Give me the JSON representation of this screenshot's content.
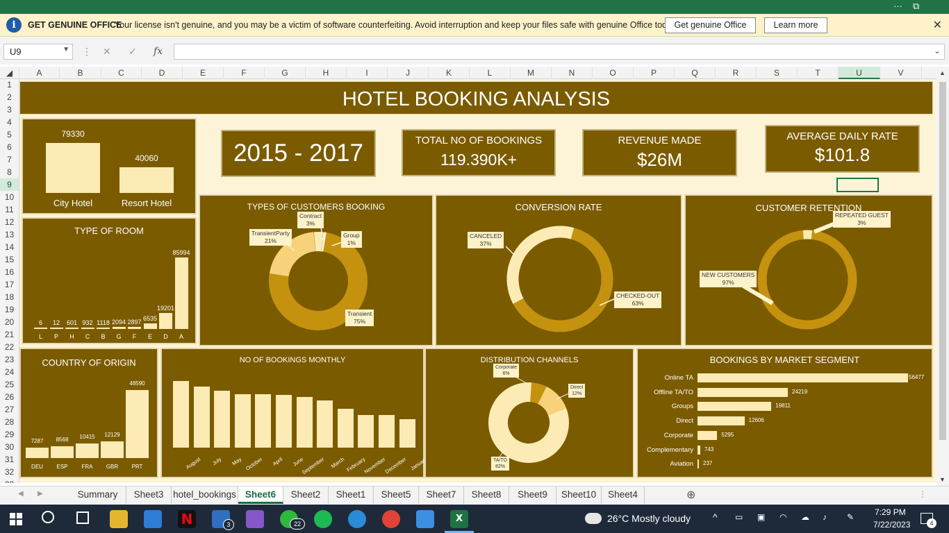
{
  "window": {
    "title_icons": [
      "more-icon",
      "restore-icon"
    ]
  },
  "banner": {
    "title": "GET GENUINE OFFICE",
    "message": "Your license isn't genuine, and you may be a victim of software counterfeiting. Avoid interruption and keep your files safe with genuine Office today.",
    "button1": "Get genuine Office",
    "button2": "Learn more",
    "close": "✕"
  },
  "formula_bar": {
    "name_box": "U9",
    "fx": "fx",
    "formula": ""
  },
  "columns": [
    "A",
    "B",
    "C",
    "D",
    "E",
    "F",
    "G",
    "H",
    "I",
    "J",
    "K",
    "L",
    "M",
    "N",
    "O",
    "P",
    "Q",
    "R",
    "S",
    "T",
    "U",
    "V"
  ],
  "selected_column": "U",
  "rows": [
    "1",
    "2",
    "3",
    "4",
    "5",
    "6",
    "7",
    "8",
    "9",
    "10",
    "11",
    "12",
    "13",
    "14",
    "15",
    "16",
    "17",
    "18",
    "19",
    "20",
    "21",
    "22",
    "23",
    "24",
    "25",
    "26",
    "27",
    "28",
    "29",
    "30",
    "31",
    "32",
    "33"
  ],
  "selected_row": "9",
  "dashboard": {
    "title": "HOTEL BOOKING ANALYSIS",
    "kpis": {
      "period": "2015 - 2017",
      "total_label": "TOTAL NO OF BOOKINGS",
      "total_value": "119.390K+",
      "revenue_label": "REVENUE MADE",
      "revenue_value": "$26M",
      "adr_label": "AVERAGE DAILY RATE",
      "adr_value": "$101.8"
    },
    "colors": {
      "panel": "#7b5b00",
      "background": "#fdf4d8",
      "light": "#fdebb5",
      "gold": "#c4920e"
    }
  },
  "chart_data": [
    {
      "id": "hotel",
      "type": "bar",
      "categories": [
        "City Hotel",
        "Resort Hotel"
      ],
      "values": [
        79330,
        40060
      ]
    },
    {
      "id": "room",
      "type": "bar",
      "title": "TYPE OF ROOM",
      "categories": [
        "L",
        "P",
        "H",
        "C",
        "B",
        "G",
        "F",
        "E",
        "D",
        "A"
      ],
      "values": [
        6,
        12,
        601,
        932,
        1118,
        2094,
        2897,
        6535,
        19201,
        85994
      ]
    },
    {
      "id": "customers",
      "type": "pie",
      "title": "TYPES OF CUSTOMERS BOOKING",
      "labels": [
        "Contract",
        "Group",
        "Transient",
        "Transient-Party"
      ],
      "values": [
        3,
        1,
        75,
        21
      ],
      "display_percent": [
        "3%",
        "1%",
        "75%",
        "21%"
      ],
      "display_labels": [
        "Contract",
        "Group",
        "Transient",
        "TransientParty"
      ]
    },
    {
      "id": "conversion",
      "type": "pie",
      "title": "CONVERSION RATE",
      "labels": [
        "CANCELED",
        "CHECKED-OUT"
      ],
      "values": [
        37,
        63
      ],
      "display_percent": [
        "37%",
        "63%"
      ]
    },
    {
      "id": "retention",
      "type": "pie",
      "title": "CUSTOMER RETENTION",
      "labels": [
        "REPEATED GUEST",
        "NEW CUSTOMERS"
      ],
      "values": [
        3,
        97
      ],
      "display_percent": [
        "3%",
        "97%"
      ]
    },
    {
      "id": "country",
      "type": "bar",
      "title": "COUNTRY OF ORIGIN",
      "categories": [
        "DEU",
        "ESP",
        "FRA",
        "GBR",
        "PRT"
      ],
      "values": [
        7287,
        8568,
        10415,
        12129,
        48590
      ]
    },
    {
      "id": "monthly",
      "type": "bar",
      "title": "NO OF BOOKINGS MONTHLY",
      "categories": [
        "August",
        "July",
        "May",
        "October",
        "April",
        "June",
        "September",
        "March",
        "February",
        "November",
        "December",
        "January"
      ],
      "values": [
        13877,
        12661,
        11791,
        11160,
        11089,
        10939,
        10508,
        9794,
        8068,
        6794,
        6780,
        5929
      ]
    },
    {
      "id": "distribution",
      "type": "pie",
      "title": "DISTRIBUTION CHANNELS",
      "labels": [
        "Corporate",
        "Direct",
        "TA/TO"
      ],
      "values": [
        6,
        12,
        82
      ],
      "display_percent": [
        "6%",
        "12%",
        "82%"
      ]
    },
    {
      "id": "market",
      "type": "bar",
      "title": "BOOKINGS BY MARKET SEGMENT",
      "categories": [
        "Online TA",
        "Offline TA/TO",
        "Groups",
        "Direct",
        "Corporate",
        "Complementary",
        "Aviation"
      ],
      "values": [
        56477,
        24219,
        19811,
        12606,
        5295,
        743,
        237
      ]
    }
  ],
  "sheet_tabs": [
    "Summary",
    "Sheet3",
    "hotel_bookings",
    "Sheet6",
    "Sheet2",
    "Sheet1",
    "Sheet5",
    "Sheet7",
    "Sheet8",
    "Sheet9",
    "Sheet10",
    "Sheet4"
  ],
  "active_tab": "Sheet6",
  "taskbar": {
    "weather": "26°C  Mostly cloudy",
    "time": "7:29 PM",
    "date": "7/22/2023",
    "mail_badge": "3",
    "whatsapp_badge": "22",
    "notif_badge": "4",
    "apps": [
      "start-icon",
      "search-icon",
      "task-view-icon",
      "file-explorer-icon",
      "store-icon",
      "netflix-icon",
      "mail-icon",
      "visual-studio-icon",
      "whatsapp-icon",
      "spotify-icon",
      "edge-icon",
      "chrome-icon",
      "photos-icon",
      "excel-icon"
    ]
  }
}
